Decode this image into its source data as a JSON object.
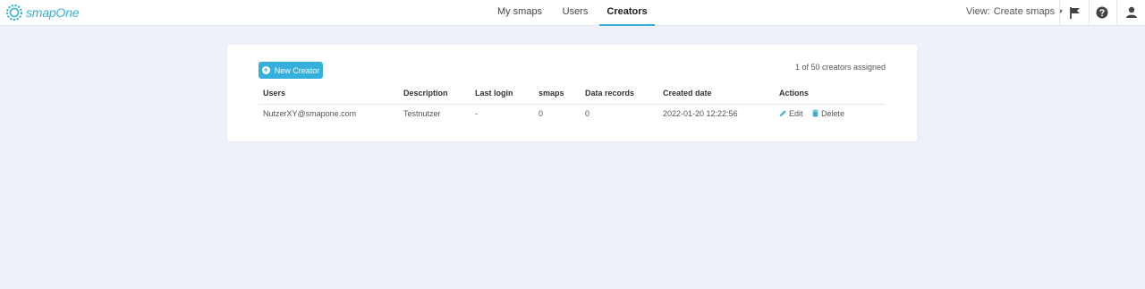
{
  "header": {
    "brand": "smapOne",
    "nav": [
      {
        "label": "My smaps",
        "active": false
      },
      {
        "label": "Users",
        "active": false
      },
      {
        "label": "Creators",
        "active": true
      }
    ],
    "view_label": "View:",
    "view_value": "Create smaps",
    "icons": [
      "flag-icon",
      "help-icon",
      "user-icon"
    ]
  },
  "card": {
    "new_button_label": "New Creator",
    "assigned_text": "1 of 50 creators assigned",
    "table": {
      "columns": [
        "Users",
        "Description",
        "Last login",
        "smaps",
        "Data records",
        "Created date",
        "Actions"
      ],
      "rows": [
        {
          "user": "NutzerXY@smapone.com",
          "description": "Testnutzer",
          "last_login": "-",
          "smaps": "0",
          "data_records": "0",
          "created_date": "2022-01-20 12:22:56",
          "edit_label": "Edit",
          "delete_label": "Delete"
        }
      ]
    }
  },
  "colors": {
    "accent": "#35afd6",
    "background": "#eef1f8",
    "card": "#ffffff"
  }
}
